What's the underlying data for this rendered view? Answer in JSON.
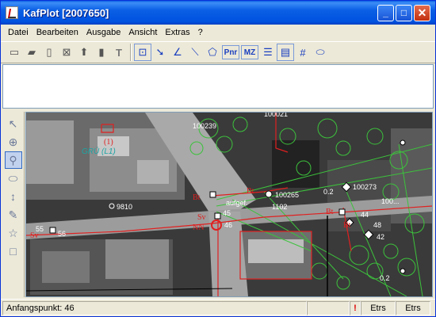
{
  "window": {
    "title": "KafPlot [2007650]"
  },
  "title_buttons": {
    "minimize": "_",
    "maximize": "□",
    "close": "✕"
  },
  "menu": [
    "Datei",
    "Bearbeiten",
    "Ausgabe",
    "Ansicht",
    "Extras",
    "?"
  ],
  "toolbar": {
    "items": [
      "new-document",
      "open-folder",
      "document-a",
      "document-x",
      "document-up",
      "document-down",
      "text-tool",
      "point-tool",
      "arrow-tool",
      "angle-tool",
      "line-tool",
      "polygon-tool"
    ],
    "pnr_label": "Pnr",
    "mz_label": "MZ",
    "trailing": [
      "list-tool",
      "property-tool",
      "grid-tool",
      "ellipse-tool"
    ]
  },
  "palette": [
    "pointer",
    "crosshair",
    "zoom",
    "pan",
    "measure",
    "pencil",
    "star",
    "rectangle"
  ],
  "map_labels": [
    {
      "text": "9810",
      "color": "#ffffff"
    },
    {
      "text": "GRÜ (L1)",
      "color": "#1ea3a3"
    },
    {
      "text": "aufgef.",
      "color": "#ffffff"
    },
    {
      "text": "100265",
      "color": "#ffffff"
    },
    {
      "text": "1102",
      "color": "#ffffff"
    },
    {
      "text": "100273",
      "color": "#ffffff"
    },
    {
      "text": "100...",
      "color": "#ffffff"
    },
    {
      "text": "46",
      "color": "#ffffff"
    },
    {
      "text": "44",
      "color": "#ffffff"
    },
    {
      "text": "48",
      "color": "#ffffff"
    },
    {
      "text": "42",
      "color": "#ffffff"
    },
    {
      "text": "45",
      "color": "#ffffff"
    },
    {
      "text": "55",
      "color": "#ffffff"
    },
    {
      "text": "56",
      "color": "#ffffff"
    },
    {
      "text": "0.2",
      "color": "#ffffff"
    },
    {
      "text": "0.2",
      "color": "#ffffff"
    },
    {
      "text": "Sv",
      "color": "#e02020"
    },
    {
      "text": "Sv",
      "color": "#e02020"
    },
    {
      "text": "Bt",
      "color": "#e02020"
    },
    {
      "text": "Bt",
      "color": "#e02020"
    },
    {
      "text": "Bt",
      "color": "#e02020"
    },
    {
      "text": "Bt",
      "color": "#e02020"
    },
    {
      "text": "NN",
      "color": "#e02020"
    },
    {
      "text": "(1)",
      "color": "#e02020"
    },
    {
      "text": "100239",
      "color": "#ffffff"
    },
    {
      "text": "100021",
      "color": "#ffffff"
    }
  ],
  "status": {
    "message": "Anfangspunkt: 46",
    "warning": "!",
    "crs1": "Etrs",
    "crs2": "Etrs"
  }
}
